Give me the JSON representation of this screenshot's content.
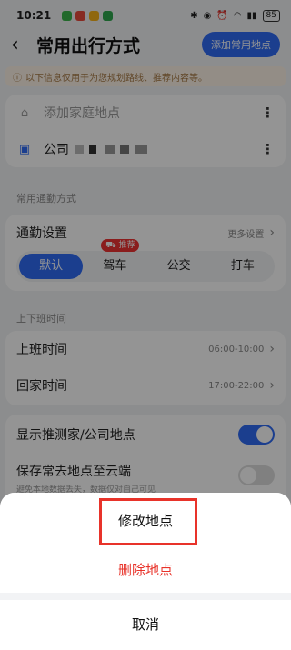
{
  "status": {
    "time": "10:21",
    "battery": "85"
  },
  "header": {
    "title": "常用出行方式",
    "add_button": "添加常用地点"
  },
  "notice": {
    "text": "以下信息仅用于为您规划路线、推荐内容等。"
  },
  "places": [
    {
      "label": "添加家庭地点"
    },
    {
      "label": "公司"
    }
  ],
  "commute_section": {
    "title": "常用通勤方式"
  },
  "commute": {
    "label": "通勤设置",
    "more": "更多设置",
    "modes": [
      {
        "label": "默认"
      },
      {
        "label": "驾车",
        "badge": "推荐"
      },
      {
        "label": "公交"
      },
      {
        "label": "打车"
      }
    ]
  },
  "schedule_section": {
    "title": "上下班时间"
  },
  "schedule": [
    {
      "label": "上班时间",
      "value": "06:00-10:00"
    },
    {
      "label": "回家时间",
      "value": "17:00-22:00"
    }
  ],
  "settings": [
    {
      "label": "显示推测家/公司地点",
      "on": true
    },
    {
      "label": "保存常去地点至云端",
      "sub": "避免本地数据丢失，数据仅对自己可见",
      "on": false
    }
  ],
  "sheet": {
    "modify": "修改地点",
    "delete": "删除地点",
    "cancel": "取消"
  },
  "colors": {
    "accent": "#2f6cf5",
    "danger": "#e8332a"
  }
}
